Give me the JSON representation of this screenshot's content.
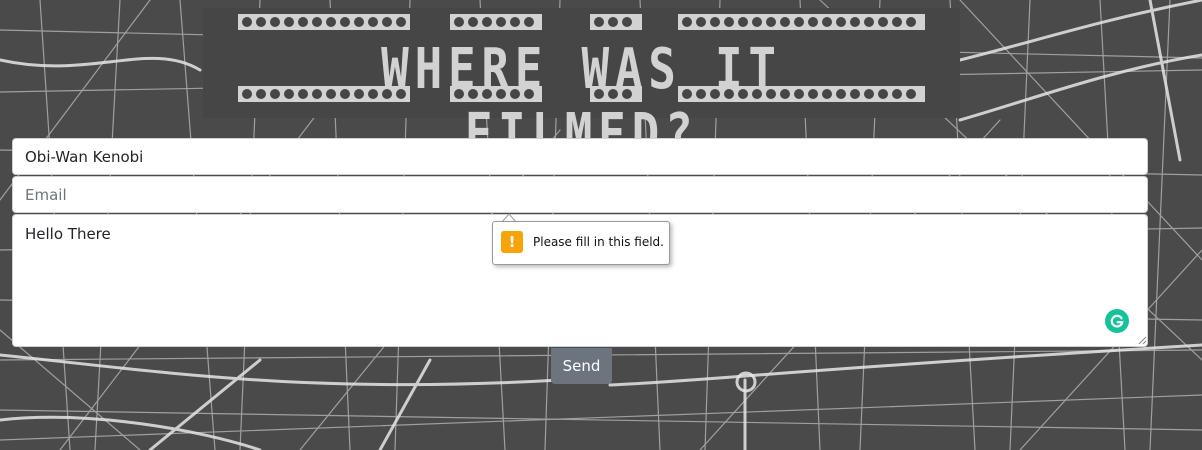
{
  "header": {
    "title": "WHERE WAS IT FILMED?"
  },
  "form": {
    "name_value": "Obi-Wan Kenobi",
    "email_placeholder": "Email",
    "email_value": "",
    "message_value": "Hello There",
    "send_label": "Send"
  },
  "validation": {
    "message": "Please fill in this field.",
    "icon": "!"
  },
  "icons": {
    "grammar": "grammarly-icon",
    "warning": "warning-icon"
  },
  "colors": {
    "page_background": "#4a4a4a",
    "map_roads": "#e6e6e6",
    "banner_background": "#464646",
    "title_text": "#d2d2d2",
    "send_button": "#6c757d",
    "warning": "#f7a30a",
    "grammarly": "#15c39a"
  }
}
